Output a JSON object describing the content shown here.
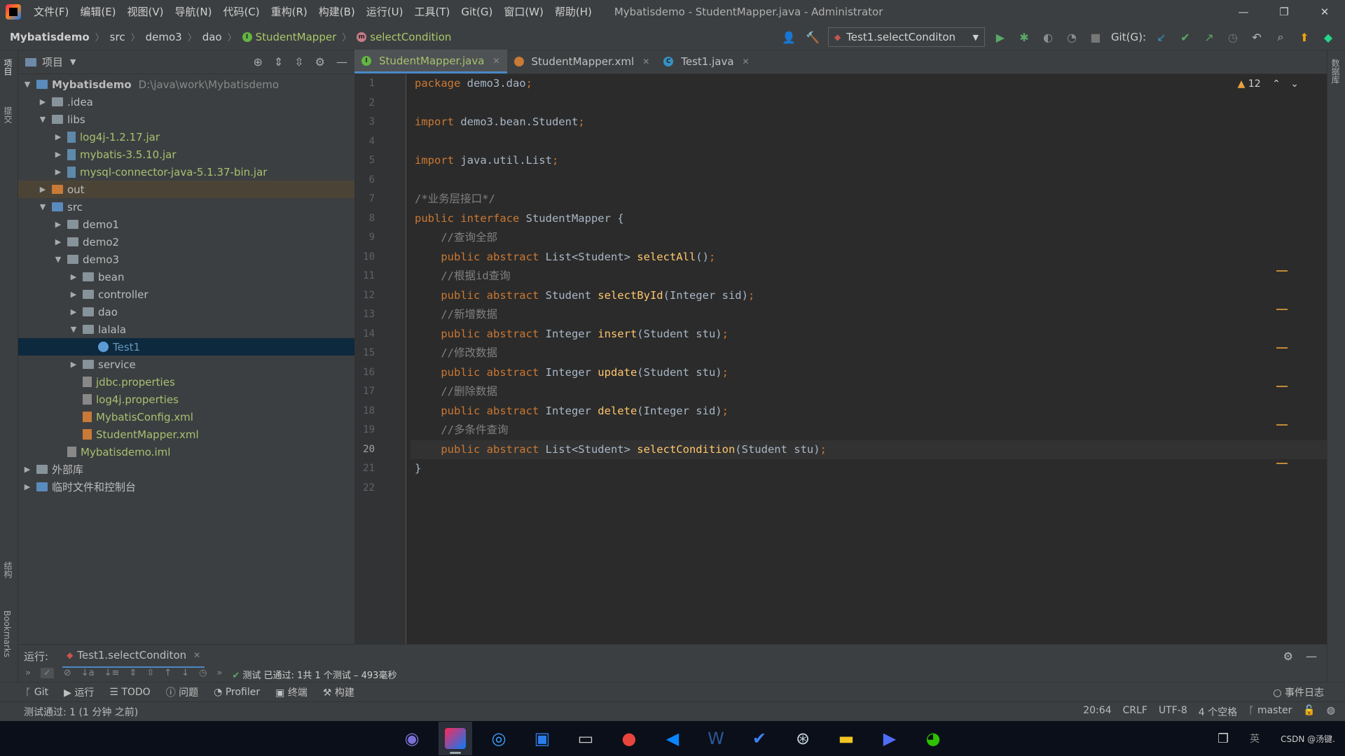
{
  "titlebar": {
    "menus": [
      "文件(F)",
      "编辑(E)",
      "视图(V)",
      "导航(N)",
      "代码(C)",
      "重构(R)",
      "构建(B)",
      "运行(U)",
      "工具(T)",
      "Git(G)",
      "窗口(W)",
      "帮助(H)"
    ],
    "window_title": "Mybatisdemo - StudentMapper.java - Administrator",
    "controls": [
      "—",
      "❐",
      "✕"
    ]
  },
  "breadcrumb": {
    "items": [
      "Mybatisdemo",
      "src",
      "demo3",
      "dao",
      "StudentMapper",
      "selectCondition"
    ]
  },
  "run_config": {
    "label": "Test1.selectConditon"
  },
  "git_label": "Git(G):",
  "project_panel": {
    "title": "项目",
    "tree": [
      {
        "label": "Mybatisdemo",
        "path": "D:\\java\\work\\Mybatisdemo",
        "depth": 0,
        "arrow": "open",
        "icon": "module",
        "style": "bold"
      },
      {
        "label": ".idea",
        "depth": 1,
        "arrow": "closed",
        "icon": "folder"
      },
      {
        "label": "libs",
        "depth": 1,
        "arrow": "open",
        "icon": "folder"
      },
      {
        "label": "log4j-1.2.17.jar",
        "depth": 2,
        "arrow": "closed",
        "icon": "jar",
        "style": "green"
      },
      {
        "label": "mybatis-3.5.10.jar",
        "depth": 2,
        "arrow": "closed",
        "icon": "jar",
        "style": "green"
      },
      {
        "label": "mysql-connector-java-5.1.37-bin.jar",
        "depth": 2,
        "arrow": "closed",
        "icon": "jar",
        "style": "green"
      },
      {
        "label": "out",
        "depth": 1,
        "arrow": "closed",
        "icon": "folder-orange",
        "style": "hl"
      },
      {
        "label": "src",
        "depth": 1,
        "arrow": "open",
        "icon": "folder-blue"
      },
      {
        "label": "demo1",
        "depth": 2,
        "arrow": "closed",
        "icon": "folder"
      },
      {
        "label": "demo2",
        "depth": 2,
        "arrow": "closed",
        "icon": "folder"
      },
      {
        "label": "demo3",
        "depth": 2,
        "arrow": "open",
        "icon": "folder"
      },
      {
        "label": "bean",
        "depth": 3,
        "arrow": "closed",
        "icon": "folder"
      },
      {
        "label": "controller",
        "depth": 3,
        "arrow": "closed",
        "icon": "folder"
      },
      {
        "label": "dao",
        "depth": 3,
        "arrow": "closed",
        "icon": "folder"
      },
      {
        "label": "lalala",
        "depth": 3,
        "arrow": "open",
        "icon": "folder"
      },
      {
        "label": "Test1",
        "depth": 4,
        "arrow": "none",
        "icon": "class",
        "style": "selected"
      },
      {
        "label": "service",
        "depth": 3,
        "arrow": "closed",
        "icon": "folder"
      },
      {
        "label": "jdbc.properties",
        "depth": 3,
        "arrow": "none",
        "icon": "props",
        "style": "green"
      },
      {
        "label": "log4j.properties",
        "depth": 3,
        "arrow": "none",
        "icon": "props",
        "style": "green"
      },
      {
        "label": "MybatisConfig.xml",
        "depth": 3,
        "arrow": "none",
        "icon": "xml",
        "style": "green"
      },
      {
        "label": "StudentMapper.xml",
        "depth": 3,
        "arrow": "none",
        "icon": "xml",
        "style": "green"
      },
      {
        "label": "Mybatisdemo.iml",
        "depth": 2,
        "arrow": "none",
        "icon": "props",
        "style": "green"
      },
      {
        "label": "外部库",
        "depth": 0,
        "arrow": "closed",
        "icon": "lib"
      },
      {
        "label": "临时文件和控制台",
        "depth": 0,
        "arrow": "closed",
        "icon": "scratch"
      }
    ]
  },
  "left_strip": {
    "top_tabs": [
      "项目",
      "提交"
    ],
    "bottom_tabs": [
      "结构",
      "Bookmarks"
    ]
  },
  "right_strip": {
    "tabs": [
      "数据库"
    ]
  },
  "editor_tabs": [
    {
      "label": "StudentMapper.java",
      "active": true,
      "icon": "interface"
    },
    {
      "label": "StudentMapper.xml",
      "active": false,
      "icon": "xml"
    },
    {
      "label": "Test1.java",
      "active": false,
      "icon": "class"
    }
  ],
  "editor": {
    "problems_count": "12",
    "current_line": 20,
    "lines": [
      [
        [
          "kw",
          "package "
        ],
        [
          "",
          "demo3.dao"
        ],
        [
          "kw",
          ";"
        ]
      ],
      [],
      [
        [
          "kw",
          "import "
        ],
        [
          "",
          "demo3.bean.Student"
        ],
        [
          "kw",
          ";"
        ]
      ],
      [],
      [
        [
          "kw",
          "import "
        ],
        [
          "",
          "java.util.List"
        ],
        [
          "kw",
          ";"
        ]
      ],
      [],
      [
        [
          "cm",
          "/*业务层接口*/"
        ]
      ],
      [
        [
          "kw",
          "public interface "
        ],
        [
          "",
          "StudentMapper {"
        ]
      ],
      [
        [
          "cm",
          "    //查询全部"
        ]
      ],
      [
        [
          "kw",
          "    public abstract "
        ],
        [
          "",
          "List<Student> "
        ],
        [
          "fn",
          "selectAll"
        ],
        [
          "",
          "()"
        ],
        [
          "kw",
          ";"
        ]
      ],
      [
        [
          "cm",
          "    //根据id查询"
        ]
      ],
      [
        [
          "kw",
          "    public abstract "
        ],
        [
          "",
          "Student "
        ],
        [
          "fn",
          "selectById"
        ],
        [
          "",
          "(Integer sid)"
        ],
        [
          "kw",
          ";"
        ]
      ],
      [
        [
          "cm",
          "    //新增数据"
        ]
      ],
      [
        [
          "kw",
          "    public abstract "
        ],
        [
          "",
          "Integer "
        ],
        [
          "fn",
          "insert"
        ],
        [
          "",
          "(Student stu)"
        ],
        [
          "kw",
          ";"
        ]
      ],
      [
        [
          "cm",
          "    //修改数据"
        ]
      ],
      [
        [
          "kw",
          "    public abstract "
        ],
        [
          "",
          "Integer "
        ],
        [
          "fn",
          "update"
        ],
        [
          "",
          "(Student stu)"
        ],
        [
          "kw",
          ";"
        ]
      ],
      [
        [
          "cm",
          "    //删除数据"
        ]
      ],
      [
        [
          "kw",
          "    public abstract "
        ],
        [
          "",
          "Integer "
        ],
        [
          "fn",
          "delete"
        ],
        [
          "",
          "(Integer sid)"
        ],
        [
          "kw",
          ";"
        ]
      ],
      [
        [
          "cm",
          "    //多条件查询"
        ]
      ],
      [
        [
          "kw",
          "    public abstract "
        ],
        [
          "",
          "List<Student> "
        ],
        [
          "fn",
          "selectCondition"
        ],
        [
          "",
          "(Student stu)"
        ],
        [
          "kw",
          ";"
        ]
      ],
      [
        [
          "",
          "}"
        ]
      ],
      []
    ]
  },
  "run_panel": {
    "label": "运行:",
    "tab": "Test1.selectConditon",
    "result": "测试 已通过: 1共 1 个测试 – 493毫秒"
  },
  "bottom_tools": {
    "items": [
      "Git",
      "运行",
      "TODO",
      "问题",
      "Profiler",
      "终端",
      "构建"
    ],
    "event_log": "事件日志"
  },
  "status": {
    "message": "测试通过: 1 (1 分钟 之前)",
    "position": "20:64",
    "line_sep": "CRLF",
    "encoding": "UTF-8",
    "indent": "4 个空格",
    "branch": "master"
  },
  "taskbar": {
    "apps": [
      "eclipse-icon",
      "intellij-icon",
      "browser-icon",
      "remote-icon",
      "terminal-icon",
      "chrome-icon",
      "vscode-icon",
      "office-icon",
      "todo-icon",
      "steam-icon",
      "explorer-icon",
      "player-icon",
      "wechat-icon"
    ],
    "tray_text": "CSDN @汤键.",
    "ime": "英"
  },
  "colors": {
    "accent": "#4a88c7",
    "keyword": "#cc7832",
    "comment": "#808080",
    "method": "#ffc66d",
    "green": "#a8c070"
  }
}
